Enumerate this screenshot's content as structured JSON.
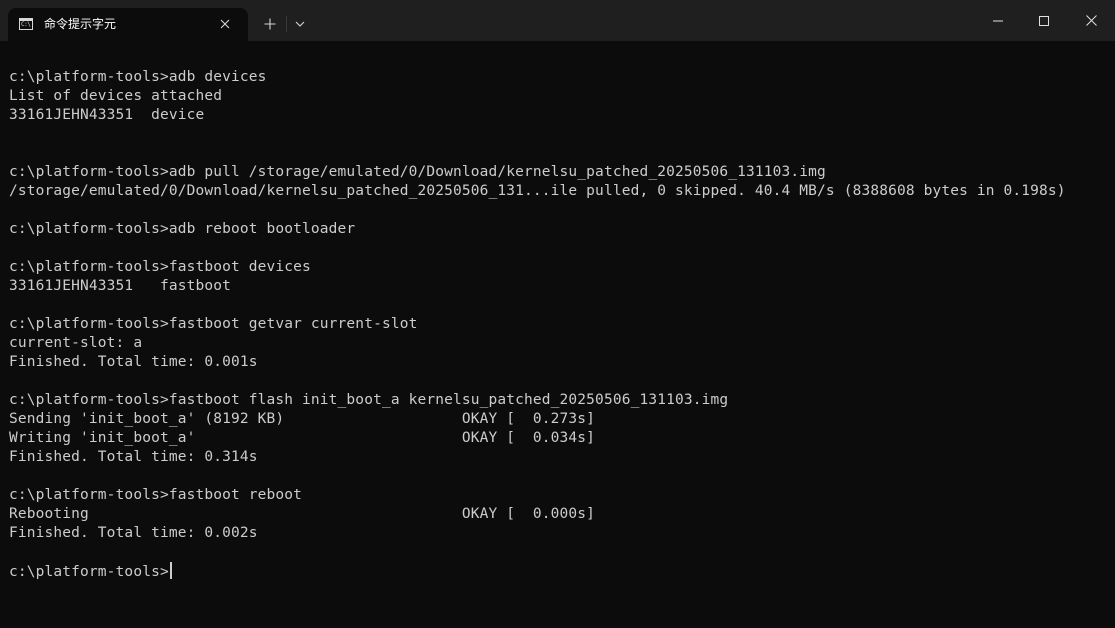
{
  "window": {
    "tab_title": "命令提示字元",
    "tab_icon": "cmd-icon",
    "tab_icon_text": "C:\\",
    "controls": [
      "minimize-icon",
      "maximize-icon",
      "close-icon"
    ]
  },
  "terminal": {
    "lines": [
      "c:\\platform-tools>adb devices",
      "List of devices attached",
      "33161JEHN43351  device",
      "",
      "",
      "c:\\platform-tools>adb pull /storage/emulated/0/Download/kernelsu_patched_20250506_131103.img",
      "/storage/emulated/0/Download/kernelsu_patched_20250506_131...ile pulled, 0 skipped. 40.4 MB/s (8388608 bytes in 0.198s)",
      "",
      "c:\\platform-tools>adb reboot bootloader",
      "",
      "c:\\platform-tools>fastboot devices",
      "33161JEHN43351   fastboot",
      "",
      "c:\\platform-tools>fastboot getvar current-slot",
      "current-slot: a",
      "Finished. Total time: 0.001s",
      "",
      "c:\\platform-tools>fastboot flash init_boot_a kernelsu_patched_20250506_131103.img",
      "Sending 'init_boot_a' (8192 KB)                    OKAY [  0.273s]",
      "Writing 'init_boot_a'                              OKAY [  0.034s]",
      "Finished. Total time: 0.314s",
      "",
      "c:\\platform-tools>fastboot reboot",
      "Rebooting                                          OKAY [  0.000s]",
      "Finished. Total time: 0.002s",
      ""
    ],
    "prompt": "c:\\platform-tools>"
  }
}
